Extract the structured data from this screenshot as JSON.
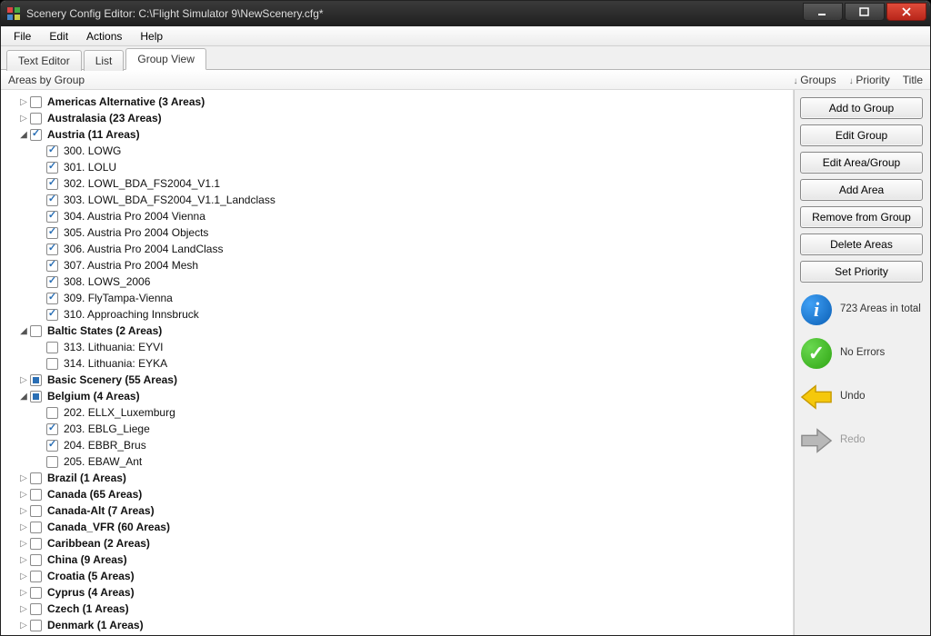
{
  "window": {
    "title": "Scenery Config Editor: C:\\Flight Simulator 9\\NewScenery.cfg*"
  },
  "menu": {
    "file": "File",
    "edit": "Edit",
    "actions": "Actions",
    "help": "Help"
  },
  "tabs": {
    "text_editor": "Text Editor",
    "list": "List",
    "group_view": "Group View"
  },
  "columns": {
    "areas_by_group": "Areas by Group",
    "groups": "Groups",
    "priority": "Priority",
    "title": "Title"
  },
  "sidebar": {
    "add_to_group": "Add to Group",
    "edit_group": "Edit Group",
    "edit_area_group": "Edit Area/Group",
    "add_area": "Add Area",
    "remove_from_group": "Remove from Group",
    "delete_areas": "Delete Areas",
    "set_priority": "Set Priority",
    "info": "723 Areas in total",
    "no_errors": "No Errors",
    "undo": "Undo",
    "redo": "Redo"
  },
  "tree": [
    {
      "type": "group",
      "exp": "closed",
      "cb": "unchecked",
      "label": "Americas Alternative (3 Areas)",
      "bold": true,
      "indent": 0
    },
    {
      "type": "group",
      "exp": "closed",
      "cb": "unchecked",
      "label": "Australasia (23 Areas)",
      "bold": true,
      "indent": 0
    },
    {
      "type": "group",
      "exp": "open",
      "cb": "checked",
      "label": "Austria (11 Areas)",
      "bold": true,
      "indent": 0
    },
    {
      "type": "item",
      "exp": "none",
      "cb": "checked",
      "label": "300. LOWG",
      "indent": 1
    },
    {
      "type": "item",
      "exp": "none",
      "cb": "checked",
      "label": "301. LOLU",
      "indent": 1
    },
    {
      "type": "item",
      "exp": "none",
      "cb": "checked",
      "label": "302. LOWL_BDA_FS2004_V1.1",
      "indent": 1
    },
    {
      "type": "item",
      "exp": "none",
      "cb": "checked",
      "label": "303. LOWL_BDA_FS2004_V1.1_Landclass",
      "indent": 1
    },
    {
      "type": "item",
      "exp": "none",
      "cb": "checked",
      "label": "304. Austria Pro 2004 Vienna",
      "indent": 1
    },
    {
      "type": "item",
      "exp": "none",
      "cb": "checked",
      "label": "305. Austria Pro 2004 Objects",
      "indent": 1
    },
    {
      "type": "item",
      "exp": "none",
      "cb": "checked",
      "label": "306. Austria Pro 2004 LandClass",
      "indent": 1
    },
    {
      "type": "item",
      "exp": "none",
      "cb": "checked",
      "label": "307. Austria Pro 2004 Mesh",
      "indent": 1
    },
    {
      "type": "item",
      "exp": "none",
      "cb": "checked",
      "label": "308. LOWS_2006",
      "indent": 1
    },
    {
      "type": "item",
      "exp": "none",
      "cb": "checked",
      "label": "309. FlyTampa-Vienna",
      "indent": 1
    },
    {
      "type": "item",
      "exp": "none",
      "cb": "checked",
      "label": "310. Approaching Innsbruck",
      "indent": 1
    },
    {
      "type": "group",
      "exp": "open",
      "cb": "unchecked",
      "label": "Baltic States (2 Areas)",
      "bold": true,
      "indent": 0
    },
    {
      "type": "item",
      "exp": "none",
      "cb": "unchecked",
      "label": "313. Lithuania: EYVI",
      "indent": 1
    },
    {
      "type": "item",
      "exp": "none",
      "cb": "unchecked",
      "label": "314. Lithuania: EYKA",
      "indent": 1
    },
    {
      "type": "group",
      "exp": "closed",
      "cb": "partial",
      "label": "Basic Scenery (55 Areas)",
      "bold": true,
      "indent": 0
    },
    {
      "type": "group",
      "exp": "open",
      "cb": "partial",
      "label": "Belgium (4 Areas)",
      "bold": true,
      "indent": 0
    },
    {
      "type": "item",
      "exp": "none",
      "cb": "unchecked",
      "label": "202. ELLX_Luxemburg",
      "indent": 1
    },
    {
      "type": "item",
      "exp": "none",
      "cb": "checked",
      "label": "203. EBLG_Liege",
      "indent": 1
    },
    {
      "type": "item",
      "exp": "none",
      "cb": "checked",
      "label": "204. EBBR_Brus",
      "indent": 1
    },
    {
      "type": "item",
      "exp": "none",
      "cb": "unchecked",
      "label": "205. EBAW_Ant",
      "indent": 1
    },
    {
      "type": "group",
      "exp": "closed",
      "cb": "unchecked",
      "label": "Brazil (1 Areas)",
      "bold": true,
      "indent": 0
    },
    {
      "type": "group",
      "exp": "closed",
      "cb": "unchecked",
      "label": "Canada (65 Areas)",
      "bold": true,
      "indent": 0
    },
    {
      "type": "group",
      "exp": "closed",
      "cb": "unchecked",
      "label": "Canada-Alt (7 Areas)",
      "bold": true,
      "indent": 0
    },
    {
      "type": "group",
      "exp": "closed",
      "cb": "unchecked",
      "label": "Canada_VFR (60 Areas)",
      "bold": true,
      "indent": 0
    },
    {
      "type": "group",
      "exp": "closed",
      "cb": "unchecked",
      "label": "Caribbean (2 Areas)",
      "bold": true,
      "indent": 0
    },
    {
      "type": "group",
      "exp": "closed",
      "cb": "unchecked",
      "label": "China (9 Areas)",
      "bold": true,
      "indent": 0
    },
    {
      "type": "group",
      "exp": "closed",
      "cb": "unchecked",
      "label": "Croatia (5 Areas)",
      "bold": true,
      "indent": 0
    },
    {
      "type": "group",
      "exp": "closed",
      "cb": "unchecked",
      "label": "Cyprus (4 Areas)",
      "bold": true,
      "indent": 0
    },
    {
      "type": "group",
      "exp": "closed",
      "cb": "unchecked",
      "label": "Czech (1 Areas)",
      "bold": true,
      "indent": 0
    },
    {
      "type": "group",
      "exp": "closed",
      "cb": "unchecked",
      "label": "Denmark (1 Areas)",
      "bold": true,
      "indent": 0
    }
  ]
}
